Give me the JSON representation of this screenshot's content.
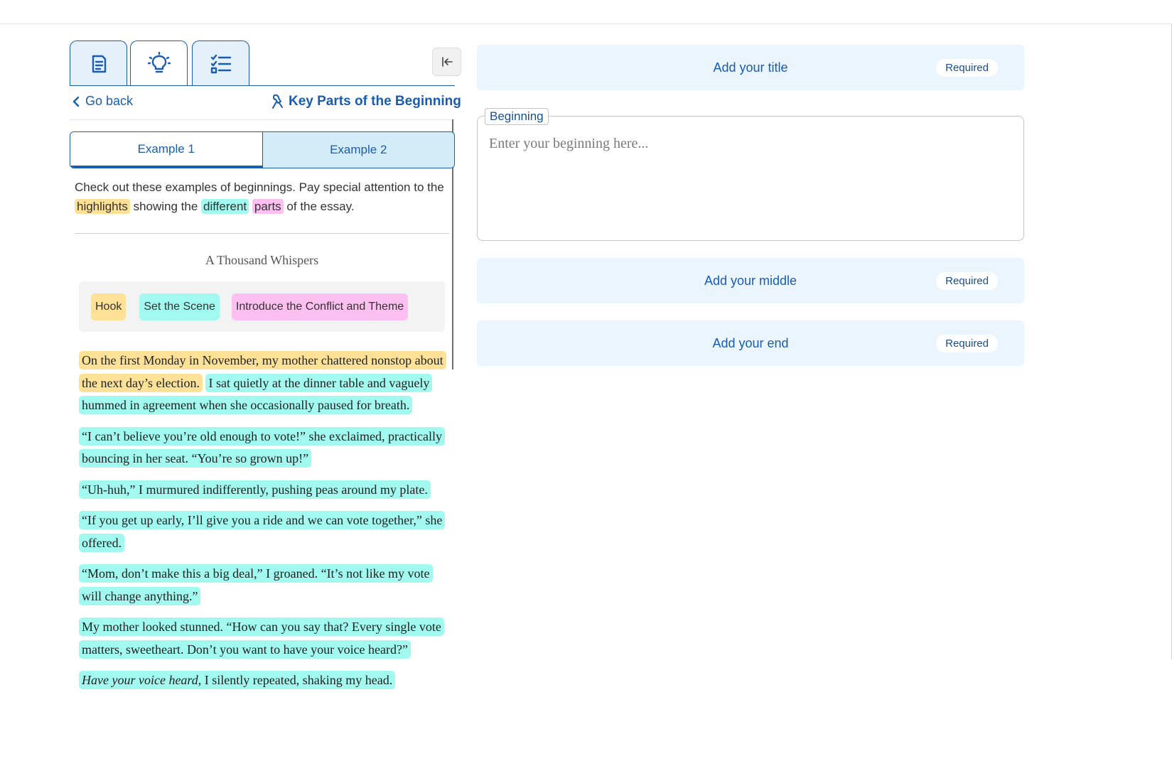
{
  "tabs": [
    {
      "icon": "document-icon",
      "active": false
    },
    {
      "icon": "lightbulb-icon",
      "active": true
    },
    {
      "icon": "checklist-icon",
      "active": false
    }
  ],
  "nav": {
    "go_back": "Go back",
    "section_title": "Key Parts of the Beginning"
  },
  "examples": {
    "tab1": "Example 1",
    "tab2": "Example 2",
    "selected": "Example 1"
  },
  "intro": {
    "part1": "Check out these examples of beginnings. Pay special attention to the",
    "hl1": "highlights",
    "part2": "showing the",
    "hl2": "different",
    "hl3": "parts",
    "part3": "of the essay."
  },
  "essay": {
    "title": "A Thousand Whispers",
    "legend": {
      "hook": "Hook",
      "scene": "Set the Scene",
      "conflict": "Introduce the Conflict and Theme"
    },
    "paragraphs": {
      "p1_hook": "On the first Monday in November, my mother chattered nonstop about the next day’s election.",
      "p1_scene": "I sat quietly at the dinner table and vaguely hummed in agreement when she occasionally paused for breath.",
      "p2": "“I can’t believe you’re old enough to vote!” she exclaimed, practically bouncing in her seat. “You’re so grown up!”",
      "p3": "“Uh-huh,” I murmured indifferently, pushing peas around my plate.",
      "p4": "“If you get up early, I’ll give you a ride and we can vote together,” she offered.",
      "p5": "“Mom, don’t make this a big deal,” I groaned. “It’s not like my vote will change anything.”",
      "p6": "My mother looked stunned. “How can you say that? Every single vote matters, sweetheart. Don’t you want to have your voice heard?”",
      "p7_italic": "Have your voice heard",
      "p7_rest": ", I silently repeated, shaking my head."
    }
  },
  "editor": {
    "title_card": {
      "label": "Add your title",
      "badge": "Required"
    },
    "beginning": {
      "legend": "Beginning",
      "placeholder": "Enter your beginning here...",
      "value": ""
    },
    "middle_card": {
      "label": "Add your middle",
      "badge": "Required"
    },
    "end_card": {
      "label": "Add your end",
      "badge": "Required"
    }
  },
  "colors": {
    "accent": "#1a5cb0",
    "hook": "#fde196",
    "scene": "#a2f9f0",
    "conflict": "#fbbff0",
    "card_bg": "#eaf5fd"
  }
}
